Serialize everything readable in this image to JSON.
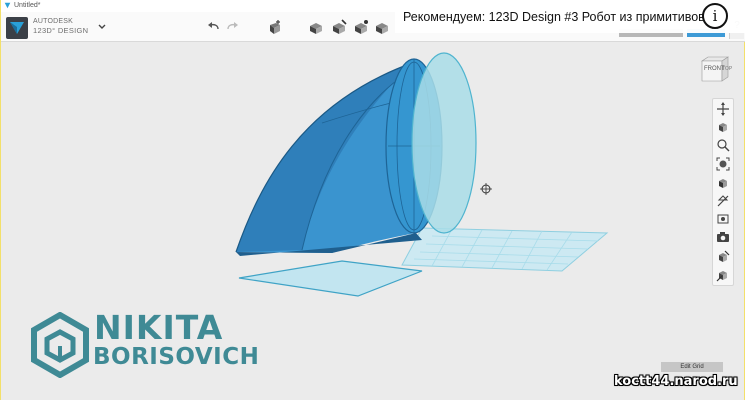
{
  "window": {
    "title": "Untitled*"
  },
  "toolbar": {
    "brand_top": "AUTODESK",
    "brand_bottom": "123D° DESIGN",
    "buttons": [
      "undo-icon",
      "redo-icon",
      "primitives-icon",
      "sketch-icon",
      "construct-icon",
      "modify-icon",
      "pattern-icon"
    ],
    "help_label": "?"
  },
  "recommend": {
    "text": "Рекомендуем: 123D Design #3 Робот из примитивов",
    "info_label": "i"
  },
  "viewcube": {
    "front_label": "FRONT",
    "top_label": "TOP"
  },
  "side_tools": [
    "pan-icon",
    "orbit-icon",
    "zoom-icon",
    "fit-icon",
    "view-cube-icon",
    "perspective-icon",
    "visibility-icon",
    "camera-icon",
    "material-icon",
    "snap-icon"
  ],
  "edit_grid": {
    "label": "Edit Grid"
  },
  "watermark": {
    "site": "koctt44.narod.ru",
    "author_line1": "NIKITA",
    "author_line2": "BORISOVICH"
  },
  "colors": {
    "accent_blue": "#3d9ad6",
    "model_blue": "#3a94cf",
    "ghost_cyan": "#a9dde8",
    "author_teal": "#3f8a95"
  }
}
